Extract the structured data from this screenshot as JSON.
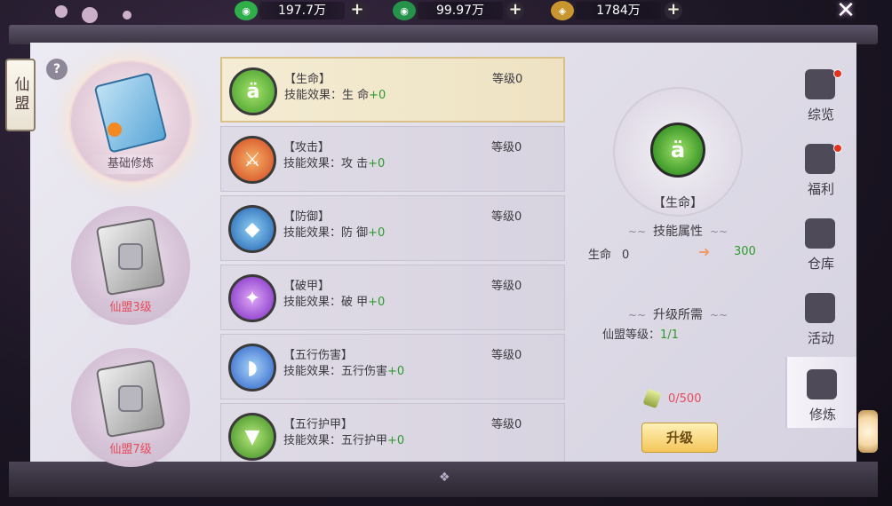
{
  "currencies": [
    {
      "name": "jade-coin",
      "icon": "green-jade-icon",
      "value": "197.7万"
    },
    {
      "name": "bound-jade",
      "icon": "locked-jade-icon",
      "value": "99.97万"
    },
    {
      "name": "copper-coin",
      "icon": "gold-coin-icon",
      "value": "1784万"
    }
  ],
  "side_tab": {
    "label": "仙盟"
  },
  "help": {
    "label": "?"
  },
  "categories": [
    {
      "label": "基础修炼",
      "state": "active"
    },
    {
      "label": "仙盟3级",
      "state": "locked"
    },
    {
      "label": "仙盟7级",
      "state": "locked"
    }
  ],
  "skills": [
    {
      "name": "【生命】",
      "effect_label": "技能效果：生 命",
      "bonus": "+0",
      "level": "等级0",
      "color": "#4caf3a"
    },
    {
      "name": "【攻击】",
      "effect_label": "技能效果：攻 击",
      "bonus": "+0",
      "level": "等级0",
      "color": "#e0642a"
    },
    {
      "name": "【防御】",
      "effect_label": "技能效果：防 御",
      "bonus": "+0",
      "level": "等级0",
      "color": "#2f7fd0"
    },
    {
      "name": "【破甲】",
      "effect_label": "技能效果：破 甲",
      "bonus": "+0",
      "level": "等级0",
      "color": "#8e3ad0"
    },
    {
      "name": "【五行伤害】",
      "effect_label": "技能效果：五行伤害",
      "bonus": "+0",
      "level": "等级0",
      "color": "#3a74d8"
    },
    {
      "name": "【五行护甲】",
      "effect_label": "技能效果：五行护甲",
      "bonus": "+0",
      "level": "等级0",
      "color": "#4aa032"
    }
  ],
  "detail": {
    "name": "【生命】",
    "attr_title": "技能属性",
    "attr_name": "生命",
    "attr_current": "0",
    "attr_next": "300",
    "req_title": "升级所需",
    "req_label": "仙盟等级：",
    "req_value": "1/1",
    "cost": "0/500",
    "upgrade_button": "升级"
  },
  "nav": [
    {
      "label": "综览",
      "badge": true
    },
    {
      "label": "福利",
      "badge": true
    },
    {
      "label": "仓库",
      "badge": false
    },
    {
      "label": "活动",
      "badge": false
    },
    {
      "label": "修炼",
      "badge": false,
      "active": true
    }
  ],
  "colors": {
    "gain": "#2e9a2e",
    "locked": "#e84a5a",
    "badge": "#e8301e"
  }
}
